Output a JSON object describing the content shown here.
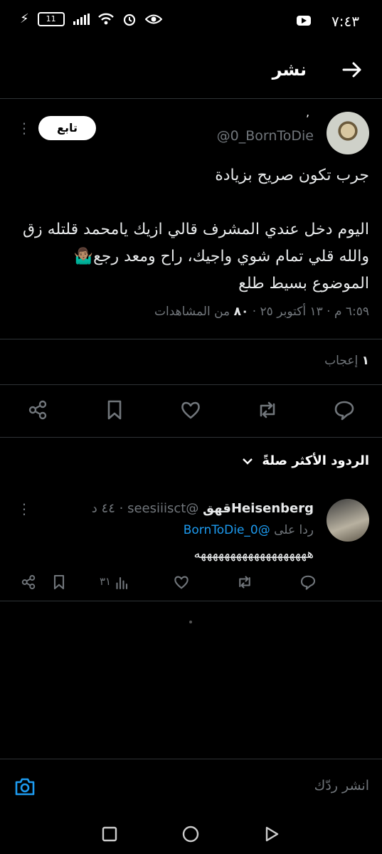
{
  "status_bar": {
    "time": "٧:٤٣",
    "battery": "11"
  },
  "header": {
    "title": "نشر"
  },
  "tweet": {
    "handle": "@0_BornToDie",
    "name_mark": "ʼ",
    "follow_label": "تابع",
    "line1": "جرب تكون صريح بزيادة",
    "body": "اليوم دخل عندي المشرف قالي ازيك يامحمد قلتله زق والله قلي تمام شوي واجيك، راح ومعد رجع🤷🏽‍♂️ الموضوع بسيط طلع",
    "time": "٦:٥٩ م · ١٣ أكتوبر ٢٥",
    "views_count": "٨٠",
    "views_label": "من المشاهدات",
    "likes_count": "١",
    "likes_label": "إعجاب"
  },
  "replies_sort": {
    "label": "الردود الأكثر صلةً"
  },
  "reply": {
    "name": "Heisenbergقهق",
    "handle": "@seesiiisct",
    "age": "· ٤٤ د",
    "replying_label": "ردا على",
    "replying_to": "@0_BornToDie",
    "text": "هههههههههههههههههههه",
    "views": "٣١"
  },
  "compose": {
    "placeholder": "انشر ردّك"
  },
  "icons": [
    "back-arrow-icon",
    "more-icon",
    "reply-icon",
    "retweet-icon",
    "like-icon",
    "bookmark-icon",
    "share-icon",
    "chevron-down-icon",
    "views-icon",
    "camera-icon",
    "back-nav-icon",
    "home-nav-icon",
    "recents-nav-icon"
  ],
  "colors": {
    "background": "#000000",
    "accent": "#1d9bf0",
    "muted": "#71767b",
    "text": "#e7e9ea"
  }
}
